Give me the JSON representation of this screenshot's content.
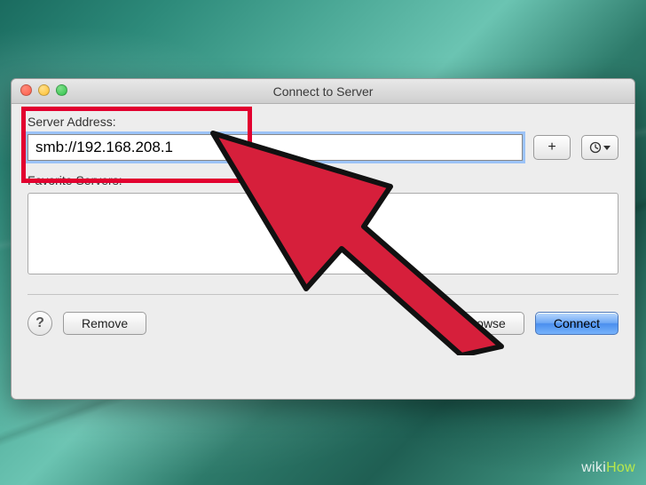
{
  "window": {
    "title": "Connect to Server",
    "server_address_label": "Server Address:",
    "server_address_value": "smb://192.168.208.1",
    "add_button_glyph": "+",
    "history_button_glyph": "⊙▾",
    "favorite_servers_label": "Favorite Servers:",
    "help_glyph": "?",
    "remove_label": "Remove",
    "browse_label": "Browse",
    "connect_label": "Connect"
  },
  "annotation": {
    "highlight_color": "#e2002f",
    "arrow_fill": "#d61f3b",
    "arrow_stroke": "#111111"
  },
  "watermark": {
    "prefix": "wiki",
    "suffix": "How"
  }
}
